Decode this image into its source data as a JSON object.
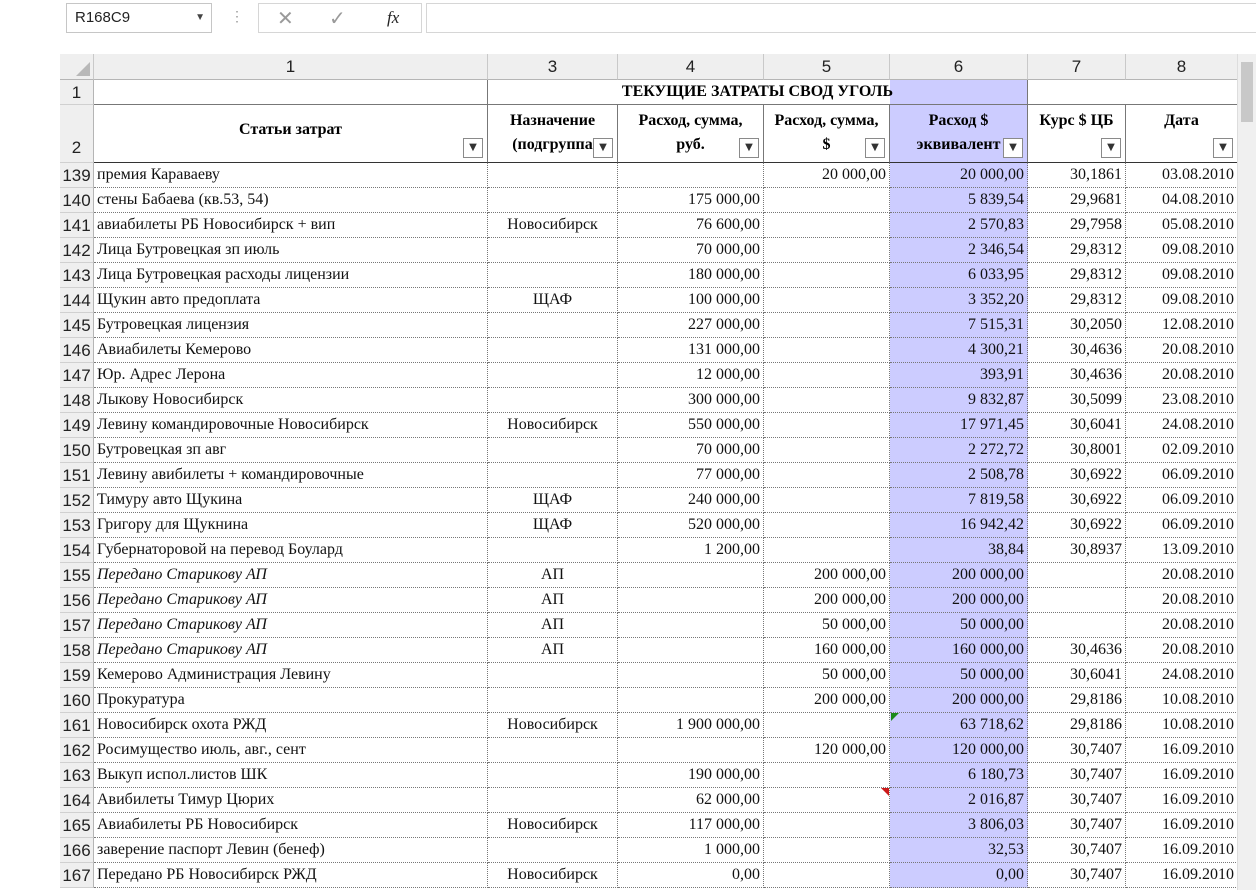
{
  "formula_bar": {
    "name_box": "R168C9",
    "cancel_glyph": "✕",
    "enter_glyph": "✓",
    "fx_label": "fx",
    "formula_value": ""
  },
  "columns": [
    "1",
    "3",
    "4",
    "5",
    "6",
    "7",
    "8"
  ],
  "title_row": {
    "row_label": "1",
    "text": "ТЕКУЩИЕ ЗАТРАТЫ СВОД УГОЛЬ"
  },
  "header_row": {
    "row_label": "2",
    "headers": [
      "Статьи затрат",
      "Назначение (подгруппа",
      "Расход, сумма, руб.",
      "Расход, сумма, $",
      "Расход $ эквивалент",
      "Курс $ ЦБ",
      "Дата"
    ]
  },
  "rows": [
    {
      "n": "139",
      "item": "премия Караваеву",
      "purpose": "",
      "rub": "",
      "usd": "20 000,00",
      "eq": "20 000,00",
      "rate": "30,1861",
      "date": "03.08.2010",
      "italic": false
    },
    {
      "n": "140",
      "item": "стены Бабаева (кв.53, 54)",
      "purpose": "",
      "rub": "175 000,00",
      "usd": "",
      "eq": "5 839,54",
      "rate": "29,9681",
      "date": "04.08.2010",
      "italic": false
    },
    {
      "n": "141",
      "item": "авиабилеты РБ Новосибирск + вип",
      "purpose": "Новосибирск",
      "rub": "76 600,00",
      "usd": "",
      "eq": "2 570,83",
      "rate": "29,7958",
      "date": "05.08.2010",
      "italic": false
    },
    {
      "n": "142",
      "item": "Лица Бутровецкая зп июль",
      "purpose": "",
      "rub": "70 000,00",
      "usd": "",
      "eq": "2 346,54",
      "rate": "29,8312",
      "date": "09.08.2010",
      "italic": false
    },
    {
      "n": "143",
      "item": "Лица Бутровецкая расходы лицензии",
      "purpose": "",
      "rub": "180 000,00",
      "usd": "",
      "eq": "6 033,95",
      "rate": "29,8312",
      "date": "09.08.2010",
      "italic": false
    },
    {
      "n": "144",
      "item": "Щукин авто предоплата",
      "purpose": "ЩАФ",
      "rub": "100 000,00",
      "usd": "",
      "eq": "3 352,20",
      "rate": "29,8312",
      "date": "09.08.2010",
      "italic": false
    },
    {
      "n": "145",
      "item": "Бутровецкая лицензия",
      "purpose": "",
      "rub": "227 000,00",
      "usd": "",
      "eq": "7 515,31",
      "rate": "30,2050",
      "date": "12.08.2010",
      "italic": false
    },
    {
      "n": "146",
      "item": "Авиабилеты Кемерово",
      "purpose": "",
      "rub": "131 000,00",
      "usd": "",
      "eq": "4 300,21",
      "rate": "30,4636",
      "date": "20.08.2010",
      "italic": false
    },
    {
      "n": "147",
      "item": "Юр. Адрес Лерона",
      "purpose": "",
      "rub": "12 000,00",
      "usd": "",
      "eq": "393,91",
      "rate": "30,4636",
      "date": "20.08.2010",
      "italic": false
    },
    {
      "n": "148",
      "item": "Лыкову Новосибирск",
      "purpose": "",
      "rub": "300 000,00",
      "usd": "",
      "eq": "9 832,87",
      "rate": "30,5099",
      "date": "23.08.2010",
      "italic": false
    },
    {
      "n": "149",
      "item": "Левину командировочные Новосибирск",
      "purpose": "Новосибирск",
      "rub": "550 000,00",
      "usd": "",
      "eq": "17 971,45",
      "rate": "30,6041",
      "date": "24.08.2010",
      "italic": false
    },
    {
      "n": "150",
      "item": "Бутровецкая зп авг",
      "purpose": "",
      "rub": "70 000,00",
      "usd": "",
      "eq": "2 272,72",
      "rate": "30,8001",
      "date": "02.09.2010",
      "italic": false
    },
    {
      "n": "151",
      "item": "Левину авибилеты + командировочные",
      "purpose": "",
      "rub": "77 000,00",
      "usd": "",
      "eq": "2 508,78",
      "rate": "30,6922",
      "date": "06.09.2010",
      "italic": false
    },
    {
      "n": "152",
      "item": "Тимуру авто Щукина",
      "purpose": "ЩАФ",
      "rub": "240 000,00",
      "usd": "",
      "eq": "7 819,58",
      "rate": "30,6922",
      "date": "06.09.2010",
      "italic": false
    },
    {
      "n": "153",
      "item": "Григору для Щукнина",
      "purpose": "ЩАФ",
      "rub": "520 000,00",
      "usd": "",
      "eq": "16 942,42",
      "rate": "30,6922",
      "date": "06.09.2010",
      "italic": false
    },
    {
      "n": "154",
      "item": "Губернаторовой на перевод Боулард",
      "purpose": "",
      "rub": "1 200,00",
      "usd": "",
      "eq": "38,84",
      "rate": "30,8937",
      "date": "13.09.2010",
      "italic": false
    },
    {
      "n": "155",
      "item": "Передано Старикову АП",
      "purpose": "АП",
      "rub": "",
      "usd": "200 000,00",
      "eq": "200 000,00",
      "rate": "",
      "date": "20.08.2010",
      "italic": true
    },
    {
      "n": "156",
      "item": "Передано Старикову АП",
      "purpose": "АП",
      "rub": "",
      "usd": "200 000,00",
      "eq": "200 000,00",
      "rate": "",
      "date": "20.08.2010",
      "italic": true
    },
    {
      "n": "157",
      "item": "Передано Старикову АП",
      "purpose": "АП",
      "rub": "",
      "usd": "50 000,00",
      "eq": "50 000,00",
      "rate": "",
      "date": "20.08.2010",
      "italic": true
    },
    {
      "n": "158",
      "item": "Передано Старикову АП",
      "purpose": "АП",
      "rub": "",
      "usd": "160 000,00",
      "eq": "160 000,00",
      "rate": "30,4636",
      "date": "20.08.2010",
      "italic": true
    },
    {
      "n": "159",
      "item": "Кемерово Администрация Левину",
      "purpose": "",
      "rub": "",
      "usd": "50 000,00",
      "eq": "50 000,00",
      "rate": "30,6041",
      "date": "24.08.2010",
      "italic": false
    },
    {
      "n": "160",
      "item": "Прокуратура",
      "purpose": "",
      "rub": "",
      "usd": "200 000,00",
      "eq": "200 000,00",
      "rate": "29,8186",
      "date": "10.08.2010",
      "italic": false
    },
    {
      "n": "161",
      "item": "Новосибирск охота РЖД",
      "purpose": "Новосибирск",
      "rub": "1 900 000,00",
      "usd": "",
      "eq": "63 718,62",
      "rate": "29,8186",
      "date": "10.08.2010",
      "italic": false
    },
    {
      "n": "162",
      "item": "Росимущество июль, авг., сент",
      "purpose": "",
      "rub": "",
      "usd": "120 000,00",
      "eq": "120 000,00",
      "rate": "30,7407",
      "date": "16.09.2010",
      "italic": false
    },
    {
      "n": "163",
      "item": "Выкуп испол.листов ШК",
      "purpose": "",
      "rub": "190 000,00",
      "usd": "",
      "eq": "6 180,73",
      "rate": "30,7407",
      "date": "16.09.2010",
      "italic": false
    },
    {
      "n": "164",
      "item": "Авибилеты Тимур Цюрих",
      "purpose": "",
      "rub": "62 000,00",
      "usd": "",
      "eq": "2 016,87",
      "rate": "30,7407",
      "date": "16.09.2010",
      "italic": false
    },
    {
      "n": "165",
      "item": "Авиабилеты РБ Новосибирск",
      "purpose": "Новосибирск",
      "rub": "117 000,00",
      "usd": "",
      "eq": "3 806,03",
      "rate": "30,7407",
      "date": "16.09.2010",
      "italic": false
    },
    {
      "n": "166",
      "item": "заверение паспорт Левин (бенеф)",
      "purpose": "",
      "rub": "1 000,00",
      "usd": "",
      "eq": "32,53",
      "rate": "30,7407",
      "date": "16.09.2010",
      "italic": false
    },
    {
      "n": "167",
      "item": "Передано РБ Новосибирск РЖД",
      "purpose": "Новосибирск",
      "rub": "0,00",
      "usd": "",
      "eq": "0,00",
      "rate": "30,7407",
      "date": "16.09.2010",
      "italic": false
    }
  ],
  "colors": {
    "highlight_column": "#ccccff",
    "header_bg": "#efefef"
  },
  "icons": {
    "filter": "dropdown-filter-icon",
    "namebox": "chevron-down-icon"
  }
}
